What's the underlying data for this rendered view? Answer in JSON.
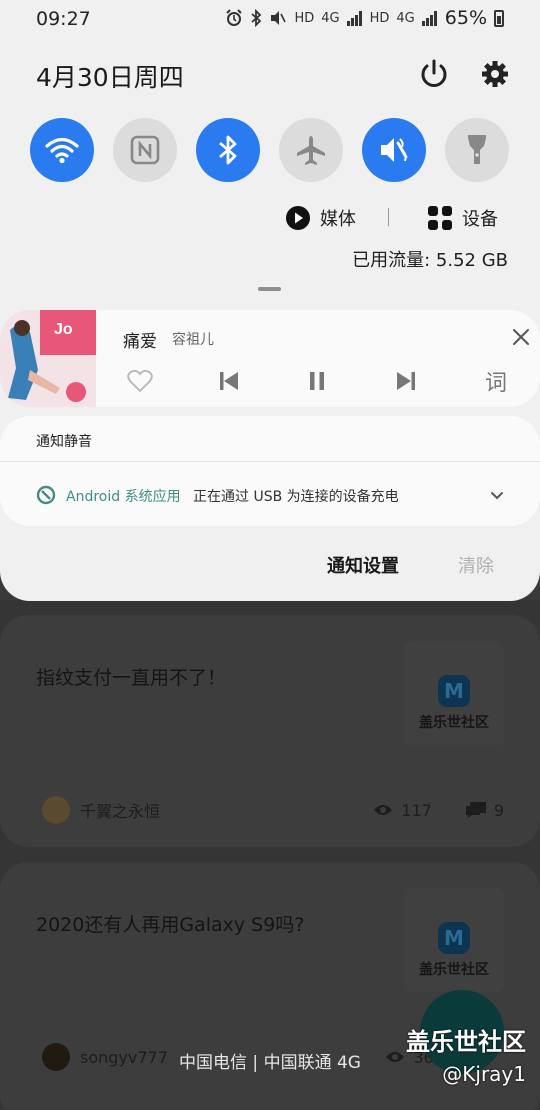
{
  "status_bar": {
    "time": "09:27",
    "hd1": "HD",
    "net1": "4G",
    "hd2": "HD",
    "net2": "4G",
    "battery_pct": "65%"
  },
  "header": {
    "date": "4月30日周四"
  },
  "quick_settings": {
    "accent": "#2a7bf0",
    "tiles": [
      {
        "name": "wifi",
        "state": "on"
      },
      {
        "name": "nfc",
        "state": "off"
      },
      {
        "name": "bluetooth",
        "state": "on"
      },
      {
        "name": "airplane",
        "state": "off"
      },
      {
        "name": "mute",
        "state": "on"
      },
      {
        "name": "flashlight",
        "state": "off"
      }
    ]
  },
  "media_bar": {
    "media_label": "媒体",
    "devices_label": "设备",
    "data_usage": "已用流量: 5.52 GB"
  },
  "music": {
    "song": "痛爱",
    "artist": "容祖儿",
    "lyric_button": "词"
  },
  "silent_notifications": {
    "header": "通知静音",
    "app_name": "Android 系统应用",
    "message": "正在通过 USB 为连接的设备充电"
  },
  "actions": {
    "settings": "通知设置",
    "clear": "清除"
  },
  "background_feed": {
    "posts": [
      {
        "title": "指纹支付一直用不了！",
        "thumb_text": "盖乐世社区",
        "author": "千翼之永恒",
        "views": "117",
        "comments": "9"
      },
      {
        "title": "2020还有人再用Galaxy S9吗?",
        "thumb_text": "盖乐世社区",
        "author": "songyv777",
        "views": "365"
      }
    ]
  },
  "carrier_text": "中国电信 | 中国联通 4G",
  "watermark": {
    "brand": "盖乐世社区",
    "user": "@Kjray1"
  }
}
